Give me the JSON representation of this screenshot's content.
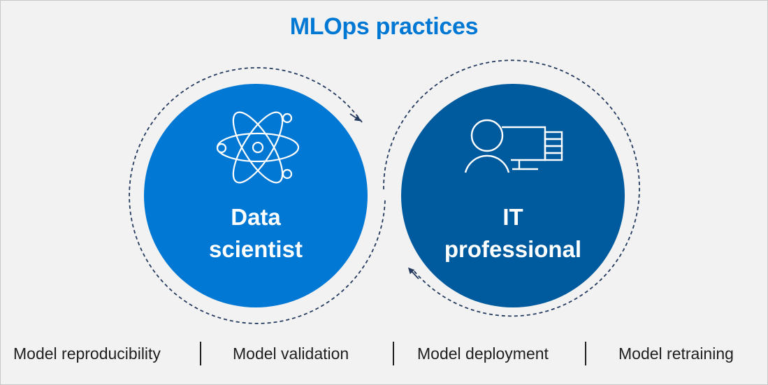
{
  "title": "MLOps practices",
  "roles": [
    {
      "line1": "Data",
      "line2": "scientist",
      "icon": "atom-icon",
      "color": "#0078d4"
    },
    {
      "line1": "IT",
      "line2": "professional",
      "icon": "person-computer-icon",
      "color": "#005a9e"
    }
  ],
  "practices": [
    "Model reproducibility",
    "Model validation",
    "Model deployment",
    "Model retraining"
  ],
  "colors": {
    "accent": "#0078d4",
    "dark_blue": "#005a9e",
    "arrow": "#243a5e",
    "background": "#f2f2f2"
  }
}
